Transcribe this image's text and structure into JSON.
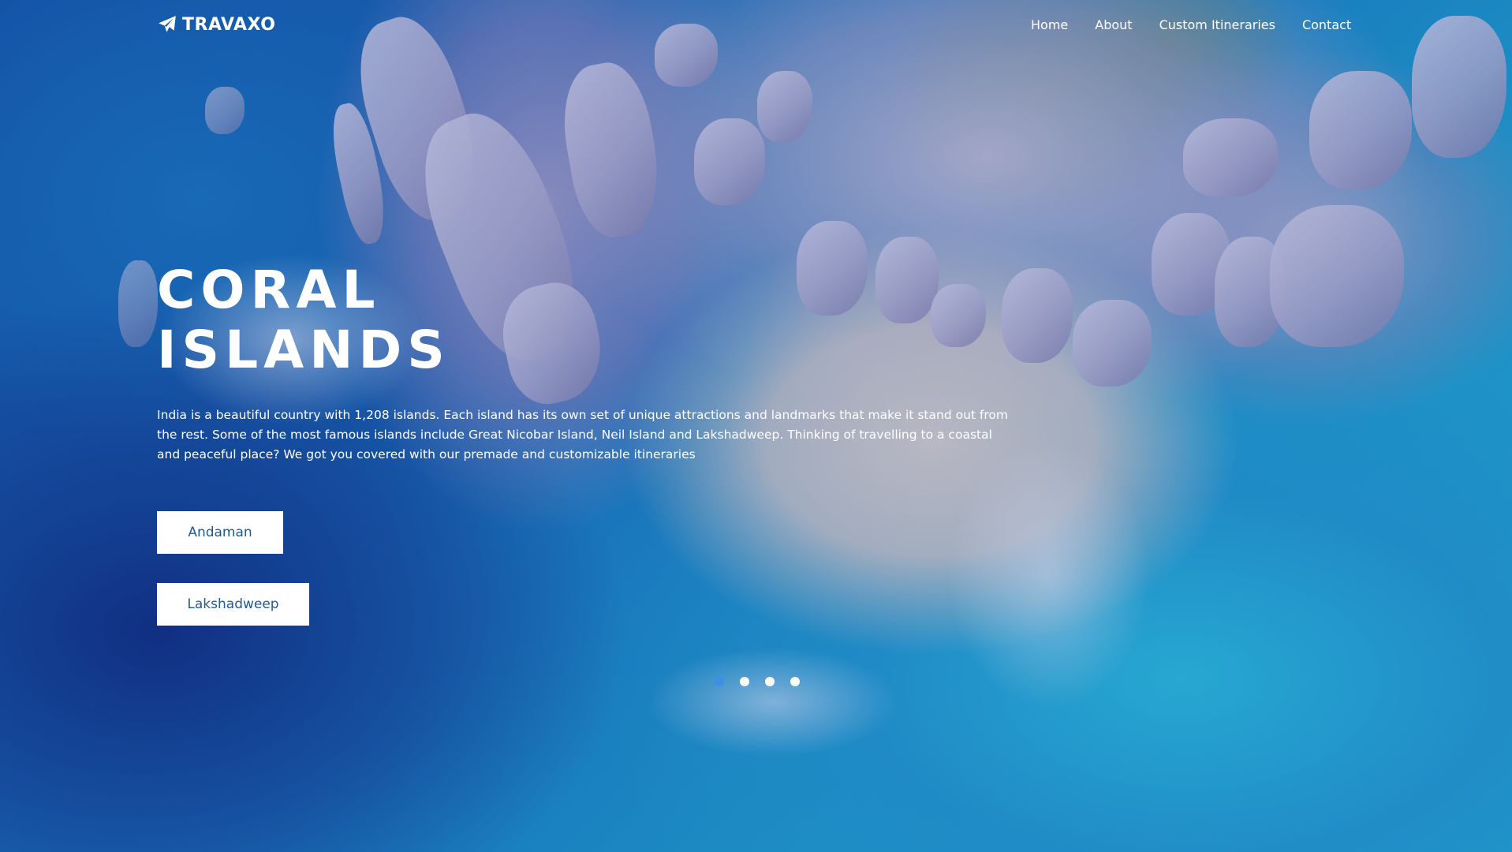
{
  "brand": {
    "name": "TRAVAXO",
    "icon": "paper-plane-icon"
  },
  "nav": {
    "items": [
      {
        "label": "Home"
      },
      {
        "label": "About"
      },
      {
        "label": "Custom Itineraries"
      },
      {
        "label": "Contact"
      }
    ]
  },
  "hero": {
    "title_line1": "CORAL",
    "title_line2": "ISLANDS",
    "description": "India is a beautiful country with 1,208 islands. Each island has its own set of unique attractions and landmarks that make it stand out from the rest. Some of the most famous islands include Great Nicobar Island, Neil Island and Lakshadweep. Thinking of travelling to a coastal and peaceful place? We got you covered with our premade and customizable itineraries",
    "buttons": [
      {
        "label": "Andaman"
      },
      {
        "label": "Lakshadweep"
      }
    ]
  },
  "carousel": {
    "slide_count": 4,
    "active_index": 0
  },
  "colors": {
    "text": "#ffffff",
    "button_bg": "#ffffff",
    "button_text": "#1f5a92",
    "active_dot": "#3e8fe6"
  }
}
